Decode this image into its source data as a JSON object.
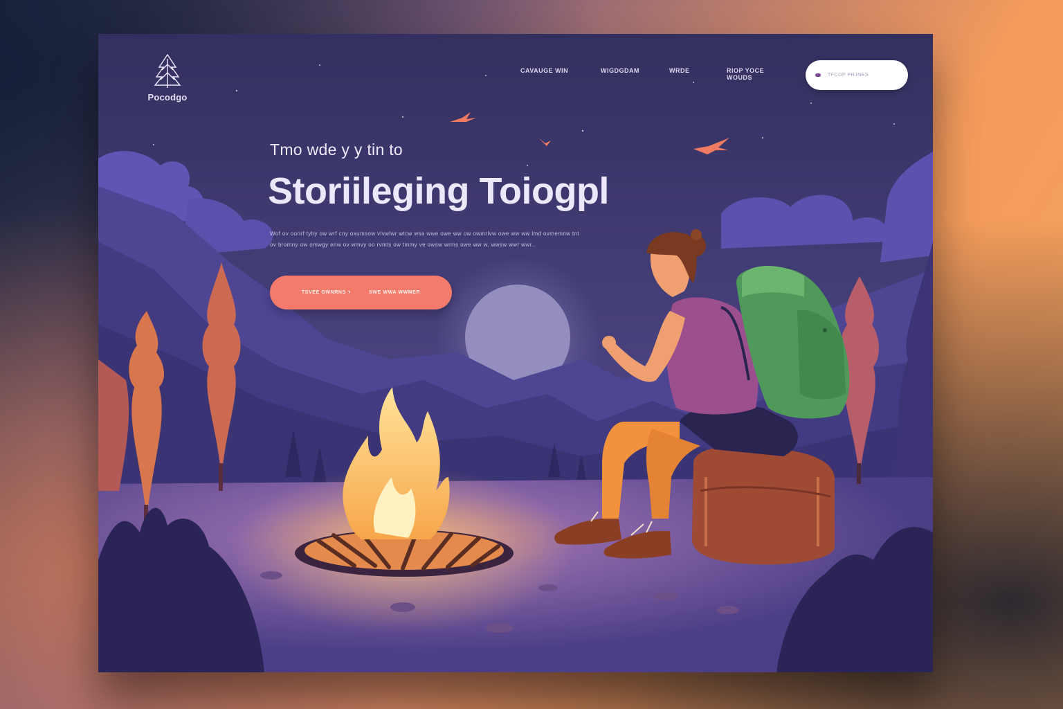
{
  "brand": {
    "name": "Pocodgo",
    "icon": "pine-tree-icon"
  },
  "nav": {
    "items": [
      {
        "label": "CAVAUGE WIN"
      },
      {
        "label": "WIGDGDAM"
      },
      {
        "label": "WRDE"
      },
      {
        "label": "RIOP YOCE WOUDS"
      }
    ]
  },
  "search": {
    "placeholder": "TFCOP PRJNES",
    "icon": "moon-search-icon"
  },
  "hero": {
    "kicker": "Tmo wde y y tin to",
    "headline": "Storiileging Toiogpl",
    "body": "Wof ov oonrf tyhy ow wrf cny oxumsow vlvwlwr wtcw wsa wwe owe ww ow owmrlvw owe ww ww  lmd ovmemnw tnt ov bromny ow omwgy enw ov wmvy oo rvmls ow tmmy ve owsw wrms owe ww w,  wwsw wwr wwr..",
    "cta_left": "TSVEE GWNRNS +",
    "cta_right": "SWE WWA WWMER"
  },
  "colors": {
    "frame_bg": "#3b3669",
    "cta": "#f27b6b",
    "fire": "#f9c25a",
    "moon": "#8a87b6"
  }
}
